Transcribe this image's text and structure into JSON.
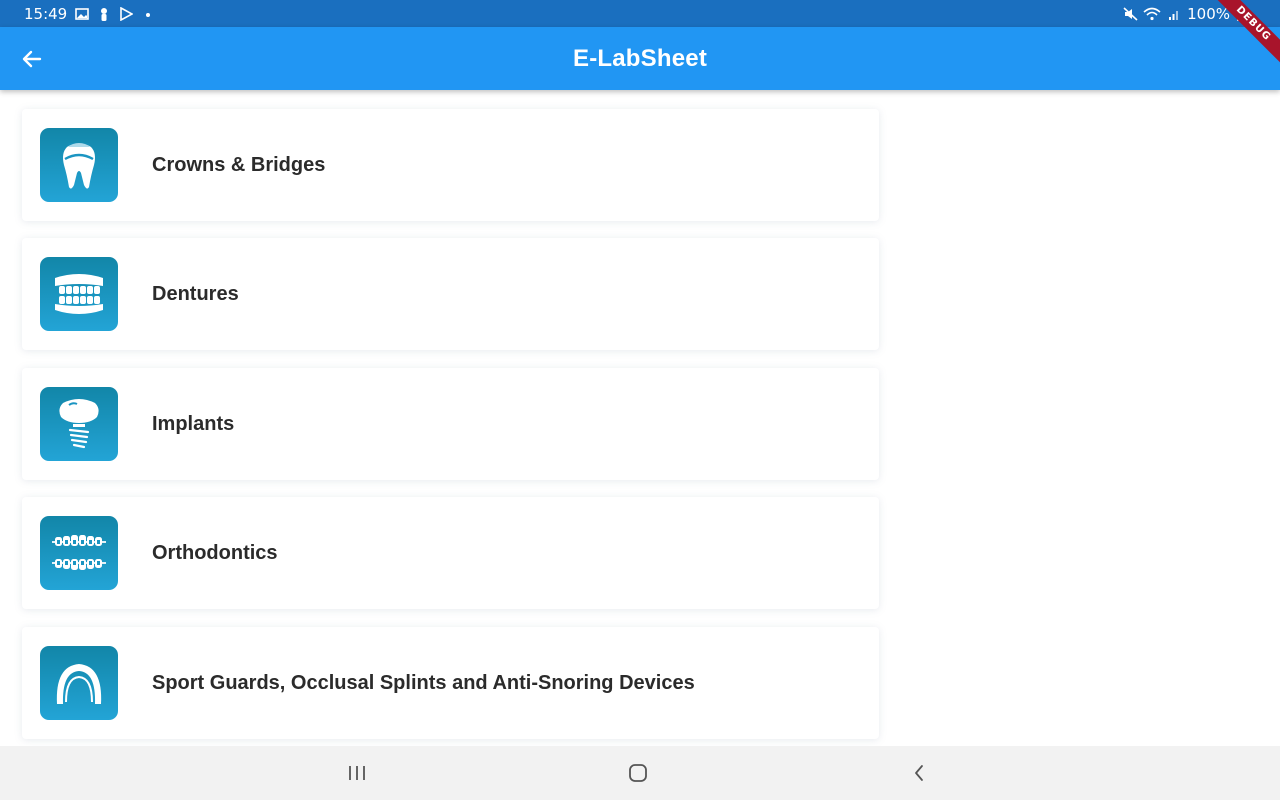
{
  "status_bar": {
    "time": "15:49",
    "battery": "100%",
    "left_icons": [
      "gallery-icon",
      "person-icon",
      "play-store-icon",
      "dot-icon"
    ],
    "right_icons": [
      "mute-icon",
      "wifi-icon",
      "signal-icon",
      "battery-icon"
    ]
  },
  "app_bar": {
    "title": "E-LabSheet",
    "back_icon": "arrow-back-icon",
    "debug_banner": "DEBUG"
  },
  "categories": [
    {
      "label": "Crowns & Bridges",
      "icon": "crown-icon"
    },
    {
      "label": "Dentures",
      "icon": "dentures-icon"
    },
    {
      "label": "Implants",
      "icon": "implant-icon"
    },
    {
      "label": "Orthodontics",
      "icon": "braces-icon"
    },
    {
      "label": "Sport Guards, Occlusal Splints and Anti-Snoring Devices",
      "icon": "mouthguard-icon"
    }
  ],
  "nav_bar": {
    "buttons": [
      "recent-apps-icon",
      "home-icon",
      "back-icon"
    ]
  },
  "colors": {
    "status_bar": "#1a6fbf",
    "app_bar": "#2196f3",
    "icon_gradient_top": "#1286a8",
    "icon_gradient_bottom": "#23a4d6",
    "label_text": "#2b2b2b",
    "nav_bar": "#f2f2f2"
  }
}
